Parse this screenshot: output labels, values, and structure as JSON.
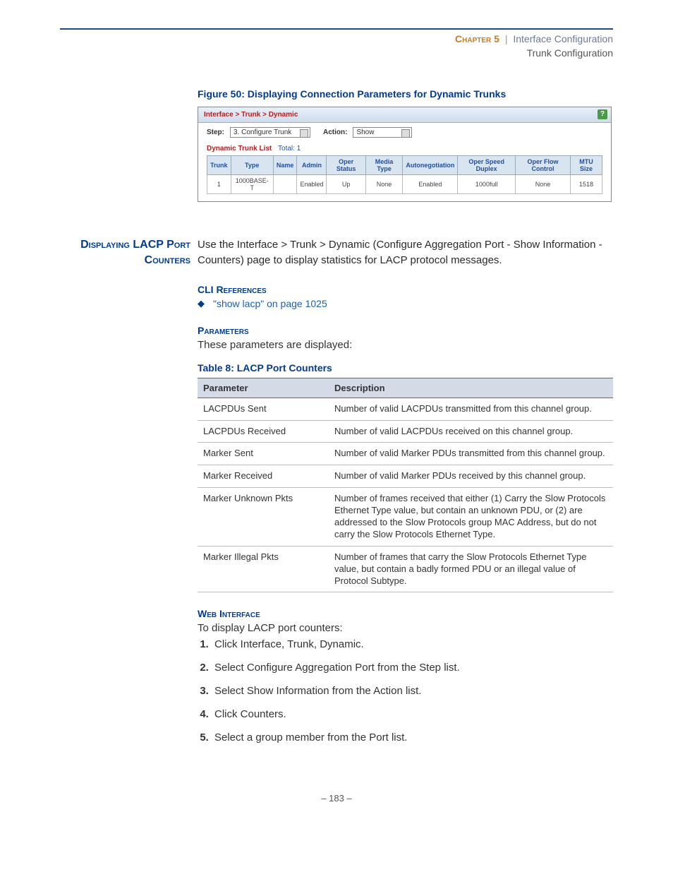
{
  "header": {
    "chapter": "Chapter 5",
    "sep": "|",
    "title": "Interface Configuration",
    "subtitle": "Trunk Configuration"
  },
  "figure": {
    "title": "Figure 50:  Displaying Connection Parameters for Dynamic Trunks"
  },
  "screenshot": {
    "breadcrumb": "Interface > Trunk > Dynamic",
    "step_label": "Step:",
    "step_value": "3. Configure Trunk",
    "action_label": "Action:",
    "action_value": "Show",
    "list_title": "Dynamic Trunk List",
    "total_label": "Total: 1",
    "columns": [
      "Trunk",
      "Type",
      "Name",
      "Admin",
      "Oper Status",
      "Media Type",
      "Autonegotiation",
      "Oper Speed Duplex",
      "Oper Flow Control",
      "MTU Size"
    ],
    "row": [
      "1",
      "1000BASE-T",
      "",
      "Enabled",
      "Up",
      "None",
      "Enabled",
      "1000full",
      "None",
      "1518"
    ]
  },
  "sidebar_heading": "Displaying LACP Port Counters",
  "intro": "Use the Interface > Trunk > Dynamic (Configure Aggregation Port - Show Information - Counters) page to display statistics for LACP protocol messages.",
  "cli": {
    "heading": "CLI References",
    "link": "\"show lacp\" on page 1025"
  },
  "parameters": {
    "heading": "Parameters",
    "intro": "These parameters are displayed:",
    "table_title": "Table 8: LACP Port Counters",
    "col1": "Parameter",
    "col2": "Description",
    "rows": [
      {
        "p": "LACPDUs Sent",
        "d": "Number of valid LACPDUs transmitted from this channel group."
      },
      {
        "p": "LACPDUs Received",
        "d": "Number of valid LACPDUs received on this channel group."
      },
      {
        "p": "Marker Sent",
        "d": "Number of valid Marker PDUs transmitted from this channel group."
      },
      {
        "p": "Marker Received",
        "d": "Number of valid Marker PDUs received by this channel group."
      },
      {
        "p": "Marker Unknown Pkts",
        "d": "Number of frames received that either (1) Carry the Slow Protocols Ethernet Type value, but contain an unknown PDU, or (2) are addressed to the Slow Protocols group MAC Address, but do not carry the Slow Protocols Ethernet Type."
      },
      {
        "p": "Marker Illegal Pkts",
        "d": "Number of frames that carry the Slow Protocols Ethernet Type value, but contain a badly formed PDU or an illegal value of Protocol Subtype."
      }
    ]
  },
  "web": {
    "heading": "Web Interface",
    "intro": "To display LACP port counters:",
    "steps": [
      "Click Interface, Trunk, Dynamic.",
      "Select Configure Aggregation Port from the Step list.",
      "Select Show Information from the Action list.",
      "Click Counters.",
      "Select a group member from the Port list."
    ]
  },
  "footer": "–  183  –"
}
